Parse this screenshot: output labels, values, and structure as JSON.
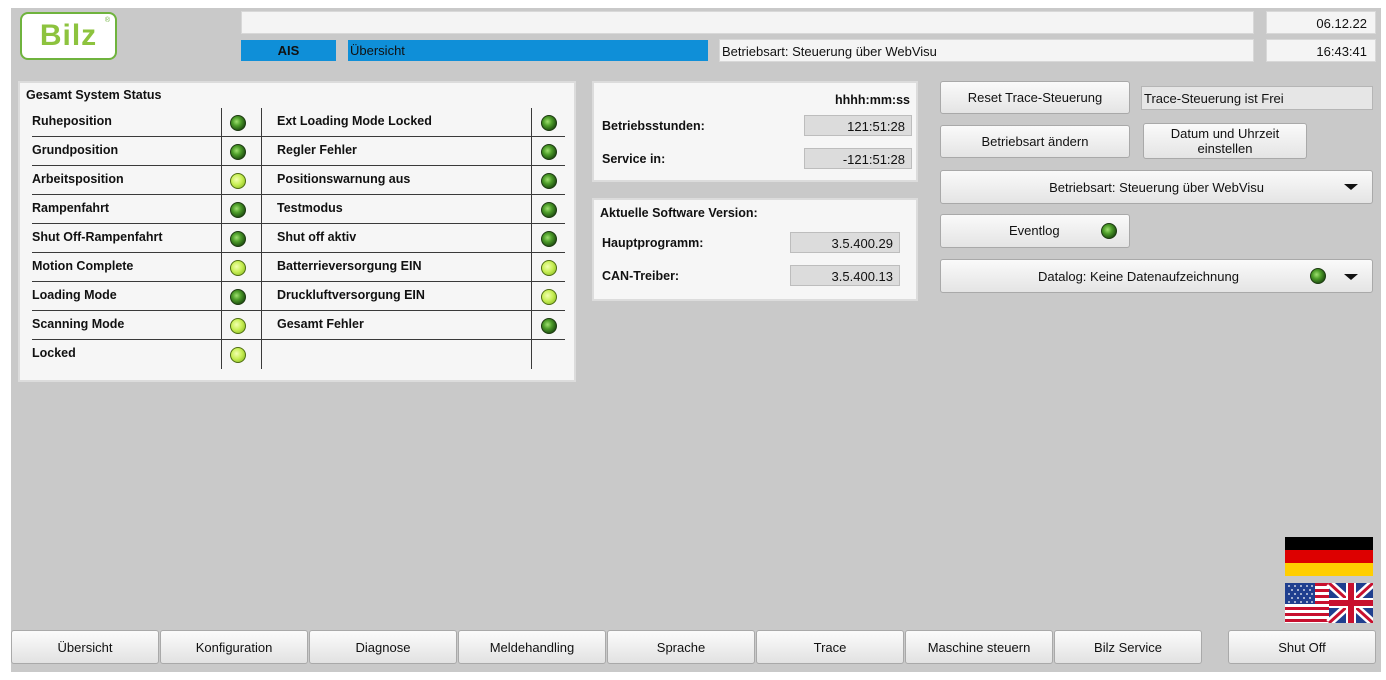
{
  "header": {
    "logo_text": "Bilz",
    "logo_reg": "®",
    "date": "06.12.22",
    "time": "16:43:41",
    "ais_label": "AIS",
    "page_label": "Übersicht",
    "mode_text": "Betriebsart: Steuerung über WebVisu"
  },
  "status": {
    "title": "Gesamt System Status",
    "left": [
      {
        "label": "Ruheposition",
        "state": "dark"
      },
      {
        "label": "Grundposition",
        "state": "dark"
      },
      {
        "label": "Arbeitsposition",
        "state": "light"
      },
      {
        "label": "Rampenfahrt",
        "state": "dark"
      },
      {
        "label": "Shut Off-Rampenfahrt",
        "state": "dark"
      },
      {
        "label": "Motion Complete",
        "state": "light"
      },
      {
        "label": "Loading Mode",
        "state": "dark"
      },
      {
        "label": "Scanning Mode",
        "state": "light"
      },
      {
        "label": "Locked",
        "state": "light"
      }
    ],
    "right": [
      {
        "label": "Ext Loading Mode Locked",
        "state": "dark"
      },
      {
        "label": "Regler Fehler",
        "state": "dark"
      },
      {
        "label": "Positionswarnung aus",
        "state": "dark"
      },
      {
        "label": "Testmodus",
        "state": "dark"
      },
      {
        "label": "Shut off aktiv",
        "state": "dark"
      },
      {
        "label": "Batterrieversorgung EIN",
        "state": "light"
      },
      {
        "label": "Druckluftversorgung EIN",
        "state": "light"
      },
      {
        "label": "Gesamt Fehler",
        "state": "dark"
      }
    ]
  },
  "hours": {
    "format_label": "hhhh:mm:ss",
    "betrieb_label": "Betriebsstunden:",
    "betrieb_value": "121:51:28",
    "service_label": "Service in:",
    "service_value": "-121:51:28"
  },
  "software": {
    "title": "Aktuelle Software Version:",
    "haupt_label": "Hauptprogramm:",
    "haupt_value": "3.5.400.29",
    "can_label": "CAN-Treiber:",
    "can_value": "3.5.400.13"
  },
  "controls": {
    "reset_trace": "Reset Trace-Steuerung",
    "trace_status": "Trace-Steuerung ist Frei",
    "betriebsart_aendern": "Betriebsart ändern",
    "datum_line1": "Datum und Uhrzeit",
    "datum_line2": "einstellen",
    "betriebsart_select": "Betriebsart: Steuerung über WebVisu",
    "eventlog": "Eventlog",
    "datalog": "Datalog: Keine Datenaufzeichnung"
  },
  "nav": [
    "Übersicht",
    "Konfiguration",
    "Diagnose",
    "Meldehandling",
    "Sprache",
    "Trace",
    "Maschine steuern",
    "Bilz Service"
  ],
  "shutoff": "Shut Off",
  "colors": {
    "accent_blue": "#0f8fd8",
    "logo_green": "#8dc33e",
    "screen_bg": "#c9c9c9"
  }
}
